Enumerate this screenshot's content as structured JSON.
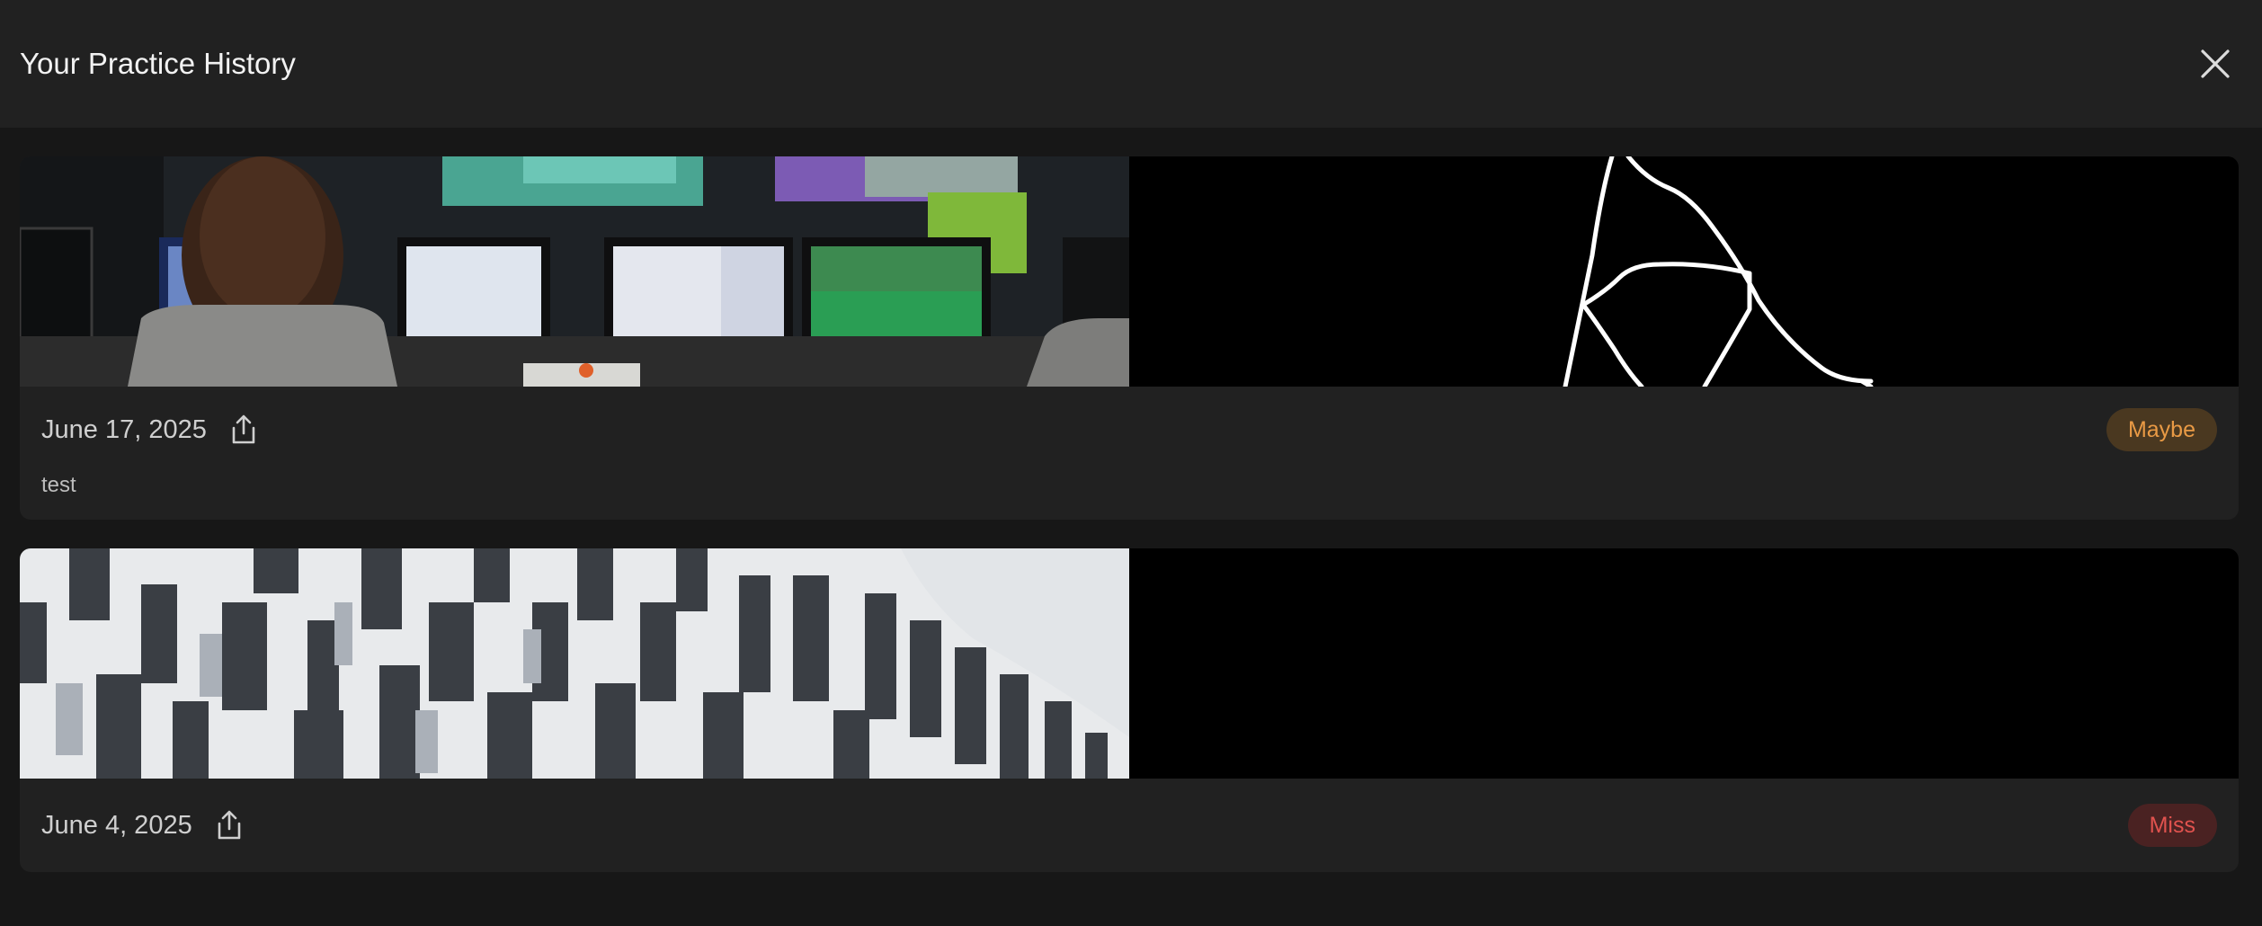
{
  "header": {
    "title": "Your Practice History",
    "close_icon": "close-icon"
  },
  "history": [
    {
      "date": "June 17, 2025",
      "note": "test",
      "result": "Maybe",
      "result_color": "#e99a45",
      "share_icon": "share-icon",
      "reference_image": "control-room-photo",
      "drawing_image": "line-sketch"
    },
    {
      "date": "June 4, 2025",
      "result": "Miss",
      "result_color": "#e0524e",
      "share_icon": "share-icon",
      "reference_image": "checkered-building-facade-photo",
      "drawing_image": "blank-canvas"
    }
  ]
}
